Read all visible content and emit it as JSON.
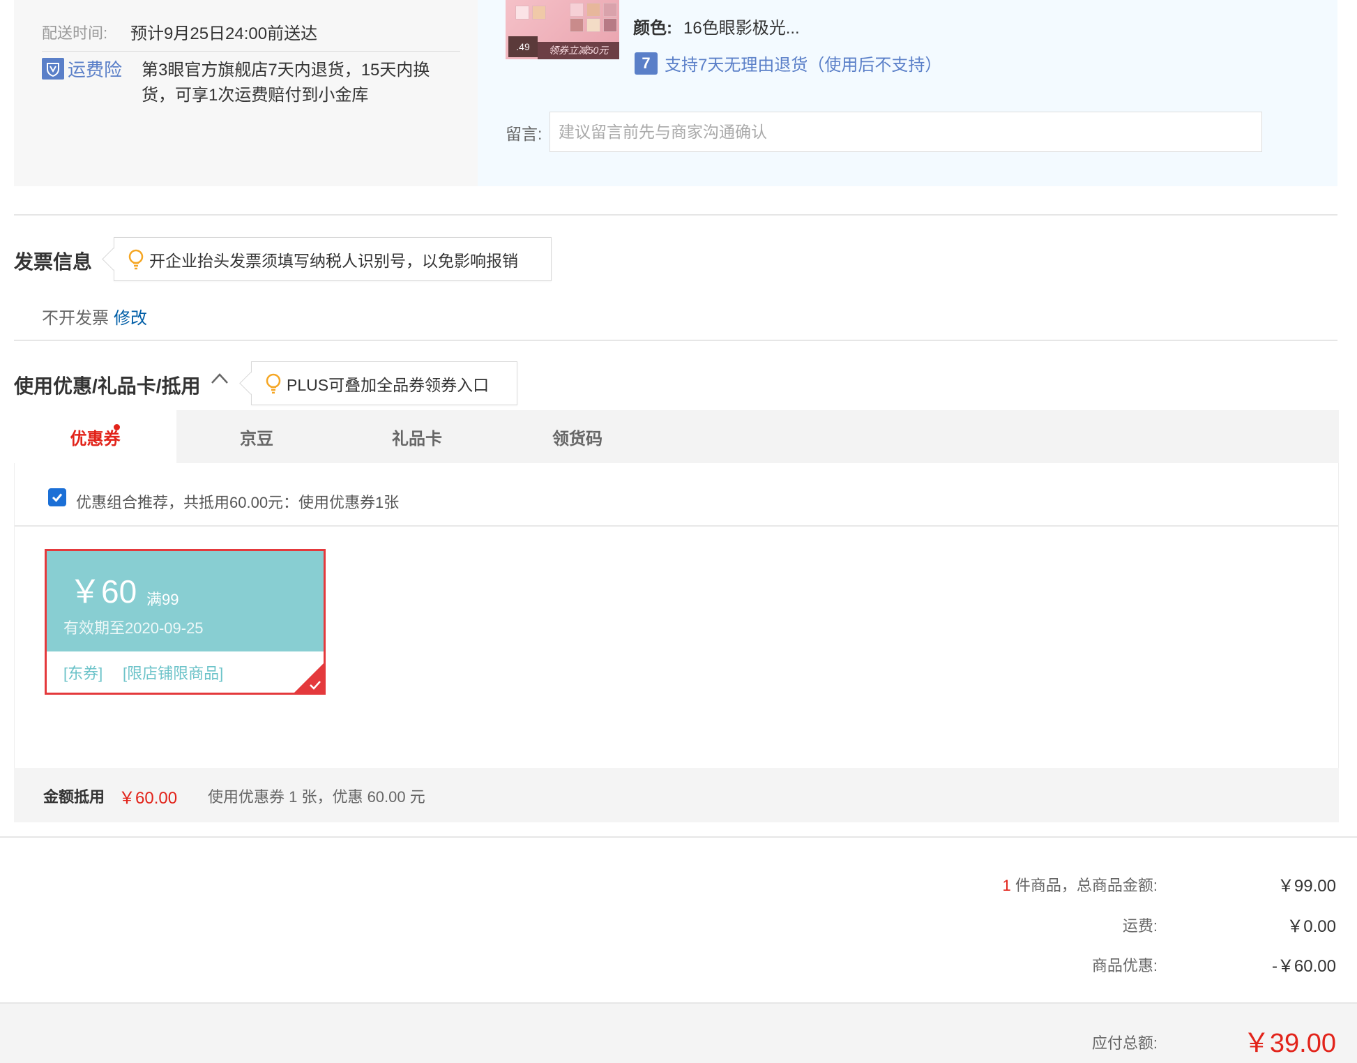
{
  "shipping": {
    "time_label": "配送时间:",
    "time_value": "预计9月25日24:00前送达",
    "insurance_label": "运费险",
    "insurance_text_line1": "第3眼官方旗舰店7天内退货，15天内换",
    "insurance_text_line2": "货，可享1次运费赔付到小金库"
  },
  "product": {
    "thumb_badge": ".49",
    "thumb_banner": "领券立减50元",
    "color_label": "颜色:",
    "color_value": "16色眼影极光...",
    "return_icon": "7",
    "return_policy": "支持7天无理由退货（使用后不支持）",
    "note_label": "留言:",
    "note_placeholder": "建议留言前先与商家沟通确认"
  },
  "invoice": {
    "title": "发票信息",
    "tip": "开企业抬头发票须填写纳税人识别号，以免影响报销",
    "status": "不开发票",
    "edit_link": "修改"
  },
  "discount": {
    "title": "使用优惠/礼品卡/抵用",
    "tip": "PLUS可叠加全品券领券入口",
    "tabs": [
      {
        "label": "优惠券"
      },
      {
        "label": "京豆"
      },
      {
        "label": "礼品卡"
      },
      {
        "label": "领货码"
      }
    ],
    "combo_text": "优惠组合推荐，共抵用60.00元：使用优惠券1张",
    "combo_checked": true,
    "coupon": {
      "amount": "￥60",
      "condition": "满99",
      "validity": "有效期至2020-09-25",
      "tag1": "[东券]",
      "tag2": "[限店铺限商品]"
    },
    "summary_label": "金额抵用",
    "summary_amount": "￥60.00",
    "summary_detail": "使用优惠券 1 张，优惠 60.00 元"
  },
  "totals": {
    "item_count": "1",
    "item_label": "件商品，总商品金额:",
    "item_amount": "￥99.00",
    "shipping_label": "运费:",
    "shipping_amount": "￥0.00",
    "discount_label": "商品优惠:",
    "discount_amount": "-￥60.00",
    "payable_label": "应付总额:",
    "payable_amount": "￥39.00"
  },
  "colors": {
    "accent_red": "#e2231a",
    "link_blue": "#005ea7",
    "coupon_teal": "#88ced2"
  }
}
